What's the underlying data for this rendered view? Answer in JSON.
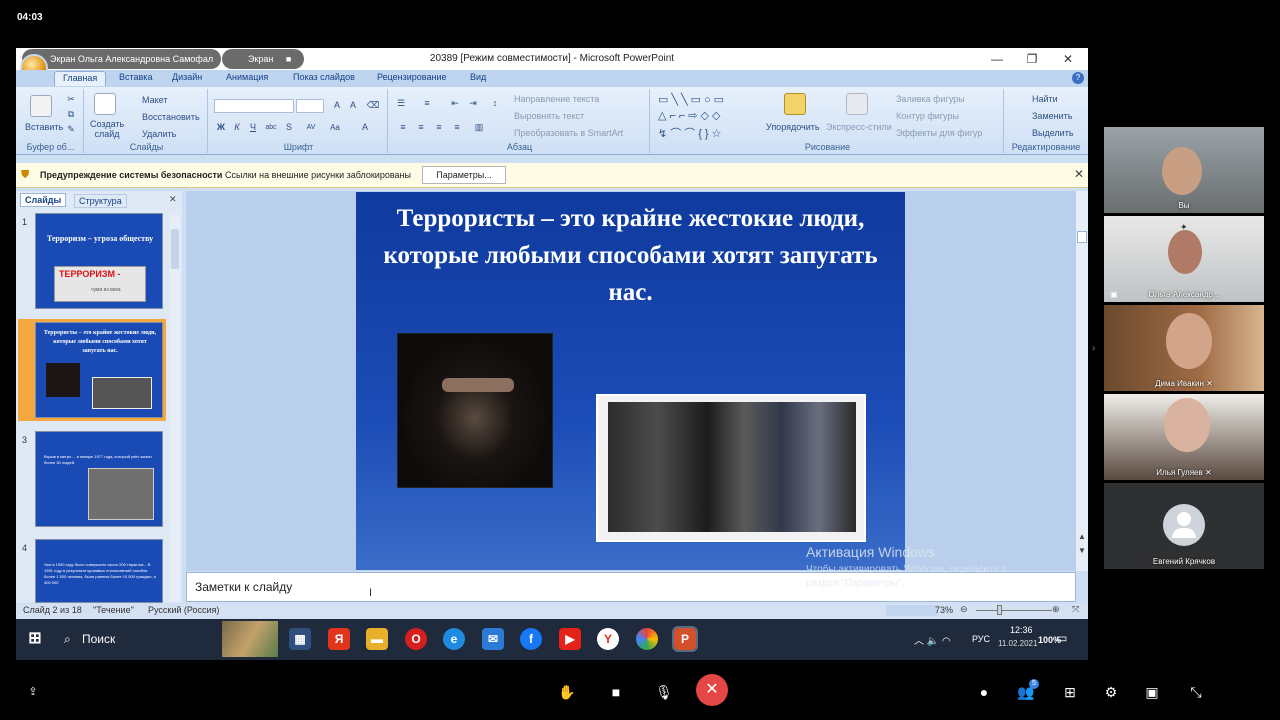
{
  "system": {
    "clock": "04:03"
  },
  "window": {
    "title": "20389 [Режим совместимости] - Microsoft PowerPoint",
    "presenter_pill": "Экран Ольга Александровна Самофал",
    "screen_pill": "Экран"
  },
  "ribbon": {
    "tabs": [
      "Главная",
      "Вставка",
      "Дизайн",
      "Анимация",
      "Показ слайдов",
      "Рецензирование",
      "Вид"
    ],
    "clipboard": {
      "paste": "Вставить",
      "label": "Буфер об..."
    },
    "slides": {
      "create": "Создать слайд",
      "layout": "Макет",
      "reset": "Восстановить",
      "delete": "Удалить",
      "label": "Слайды"
    },
    "font": {
      "label": "Шрифт"
    },
    "paragraph": {
      "direction": "Направление текста",
      "align": "Выровнять текст",
      "smartart": "Преобразовать в SmartArt",
      "label": "Абзац"
    },
    "drawing": {
      "arrange": "Упорядочить",
      "express": "Экспресс-стили",
      "fill": "Заливка фигуры",
      "outline": "Контур фигуры",
      "effects": "Эффекты для фигур",
      "label": "Рисование"
    },
    "editing": {
      "find": "Найти",
      "replace": "Заменить",
      "select": "Выделить",
      "label": "Редактирование"
    }
  },
  "security_bar": {
    "title": "Предупреждение системы безопасности",
    "message": "Ссылки на внешние рисунки заблокированы",
    "button": "Параметры..."
  },
  "left_panel": {
    "tab_slides": "Слайды",
    "tab_outline": "Структура",
    "thumbs": [
      {
        "num": "1",
        "title": "Терроризм – угроза обществу",
        "banner": "ТЕРРОРИЗМ -",
        "banner_sub": "чума из века"
      },
      {
        "num": "2",
        "title": "Террористы – это крайне жестокие люди, которые любыми способами хотят запугать нас."
      },
      {
        "num": "3",
        "text": "Взрыв в метро ... в январе 1977 года, который унёс жизни более 30 людей."
      },
      {
        "num": "4",
        "text": "Уже в 1990 году было совершено около 200 терактов... В 1991 году в результате кровавых столкновений погибли более 1 500 человек, были ранены более 10 000 граждан, а 400 000"
      }
    ]
  },
  "slide": {
    "title": "Террористы – это крайне жестокие люди, которые любыми способами хотят запугать нас."
  },
  "notes": {
    "placeholder": "Заметки к слайду"
  },
  "status": {
    "slide": "Слайд 2 из 18",
    "theme": "\"Течение\"",
    "lang": "Русский (Россия)",
    "zoom": "73%"
  },
  "watermark": {
    "title": "Активация Windows",
    "line1": "Чтобы активировать Windows, перейдите в",
    "line2": "раздел \"Параметры\"."
  },
  "taskbar": {
    "search": "Поиск",
    "lang": "РУС",
    "time": "12:36",
    "date": "11.02.2021",
    "zoom": "100%"
  },
  "participants": [
    {
      "name": "Вы"
    },
    {
      "name": "Ольга Александр..."
    },
    {
      "name": "Дима Ивакин"
    },
    {
      "name": "Илья Гуляев"
    },
    {
      "name": "Евгений Крячков"
    }
  ],
  "badge_count": "5"
}
